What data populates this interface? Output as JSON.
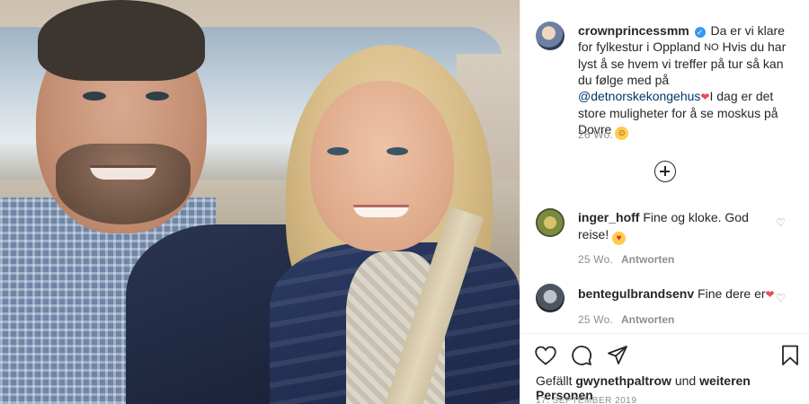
{
  "post": {
    "username": "crownprincessmm",
    "caption_parts": [
      "Da er vi klare for fylkestur i Oppland",
      "NO",
      "Hvis du har lyst å se hvem vi treffer på tur så kan du følge med på",
      "@detnorskekongehus",
      "I dag er det store muligheter for å se moskus på Dovre"
    ],
    "time": "26 Wo."
  },
  "comments": [
    {
      "username": "inger_hoff",
      "text": "Fine og kloke. God reise!",
      "time": "25 Wo.",
      "reply": "Antworten"
    },
    {
      "username": "bentegulbrandsenv",
      "text": "Fine dere er",
      "time": "25 Wo.",
      "reply": "Antworten"
    }
  ],
  "likes": {
    "prefix": "Gefällt",
    "user": "gwynethpaltrow",
    "middle": "und",
    "suffix": "weiteren Personen"
  },
  "date": "17. SEPTEMBER 2019",
  "icons": {
    "verified": "verified-badge-icon",
    "like": "heart-icon",
    "comment": "comment-icon",
    "share": "paper-plane-icon",
    "save": "bookmark-icon",
    "more": "plus-circle-icon"
  },
  "colors": {
    "link": "#00376b",
    "muted": "#8e8e8e",
    "verified": "#3897f0",
    "heart": "#ed4956"
  }
}
